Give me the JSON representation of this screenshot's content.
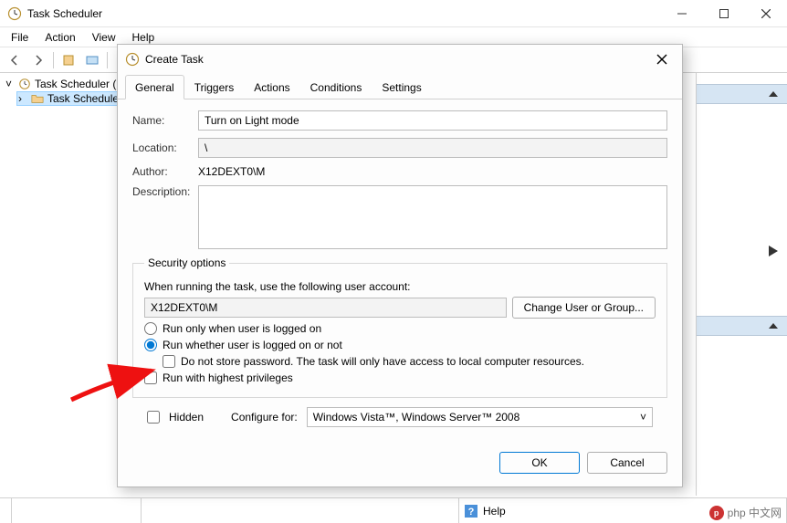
{
  "window": {
    "title": "Task Scheduler",
    "menus": [
      "File",
      "Action",
      "View",
      "Help"
    ]
  },
  "tree": {
    "root": "Task Scheduler (L",
    "child": "Task Schedule"
  },
  "bottom": {
    "help": "Help"
  },
  "dialog": {
    "title": "Create Task",
    "tabs": [
      "General",
      "Triggers",
      "Actions",
      "Conditions",
      "Settings"
    ],
    "labels": {
      "name": "Name:",
      "location": "Location:",
      "author": "Author:",
      "description": "Description:"
    },
    "values": {
      "name": "Turn on Light mode",
      "location": "\\",
      "author": "X12DEXT0\\M",
      "description": ""
    },
    "security": {
      "legend": "Security options",
      "when_running": "When running the task, use the following user account:",
      "user": "X12DEXT0\\M",
      "change_user_btn": "Change User or Group...",
      "radio_logged_on": "Run only when user is logged on",
      "radio_whether": "Run whether user is logged on or not",
      "chk_no_password": "Do not store password.  The task will only have access to local computer resources.",
      "chk_highest": "Run with highest privileges"
    },
    "footer": {
      "hidden": "Hidden",
      "configure_for_lbl": "Configure for:",
      "configure_for_val": "Windows Vista™, Windows Server™ 2008"
    },
    "buttons": {
      "ok": "OK",
      "cancel": "Cancel"
    }
  },
  "watermark": "php 中文网"
}
